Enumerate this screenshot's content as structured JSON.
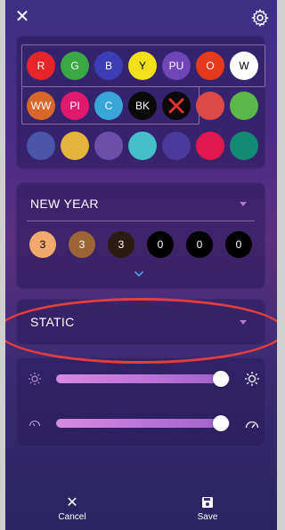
{
  "actions": {
    "cancel_label": "Cancel",
    "save_label": "Save"
  },
  "colors": {
    "row1": [
      {
        "label": "R",
        "bg": "#e8242b"
      },
      {
        "label": "G",
        "bg": "#3aa845"
      },
      {
        "label": "B",
        "bg": "#3d3db5"
      },
      {
        "label": "Y",
        "bg": "#f2e11a"
      },
      {
        "label": "PU",
        "bg": "#6f45b8"
      },
      {
        "label": "O",
        "bg": "#e53a1e"
      },
      {
        "label": "W",
        "bg": "#ffffff"
      }
    ],
    "row2": [
      {
        "label": "WW",
        "bg": "#d8672a"
      },
      {
        "label": "PI",
        "bg": "#e0186e"
      },
      {
        "label": "C",
        "bg": "#36a7d8"
      },
      {
        "label": "BK",
        "bg": "#0a0a0a"
      },
      {
        "label": "",
        "bg": "#0a0a0a",
        "icon": "x-icon",
        "icon_color": "#e23232"
      },
      {
        "label": "",
        "bg": "#dc4a45"
      },
      {
        "label": "",
        "bg": "#5bb746"
      }
    ],
    "row3": [
      {
        "bg": "#4a55a8"
      },
      {
        "bg": "#e2b43a"
      },
      {
        "bg": "#6c4faa"
      },
      {
        "bg": "#45bfc9"
      },
      {
        "bg": "#4a3a9a"
      },
      {
        "bg": "#e0184f"
      },
      {
        "bg": "#138a73"
      }
    ]
  },
  "preset": {
    "title": "NEW YEAR",
    "values": [
      {
        "text": "3",
        "bg": "#f2a96b",
        "fg": "#000"
      },
      {
        "text": "3",
        "bg": "#9b6535",
        "fg": "#fff"
      },
      {
        "text": "3",
        "bg": "#2a1a0f",
        "fg": "#fff"
      },
      {
        "text": "0",
        "bg": "#000000",
        "fg": "#fff"
      },
      {
        "text": "0",
        "bg": "#000000",
        "fg": "#fff"
      },
      {
        "text": "0",
        "bg": "#000000",
        "fg": "#fff"
      }
    ]
  },
  "mode": {
    "title": "STATIC"
  },
  "sliders": {
    "brightness": {
      "level": 0.95,
      "icon": "sun-icon"
    },
    "speed": {
      "level": 0.95,
      "icon": "speedometer-icon"
    }
  },
  "accent": "#e63d3d"
}
